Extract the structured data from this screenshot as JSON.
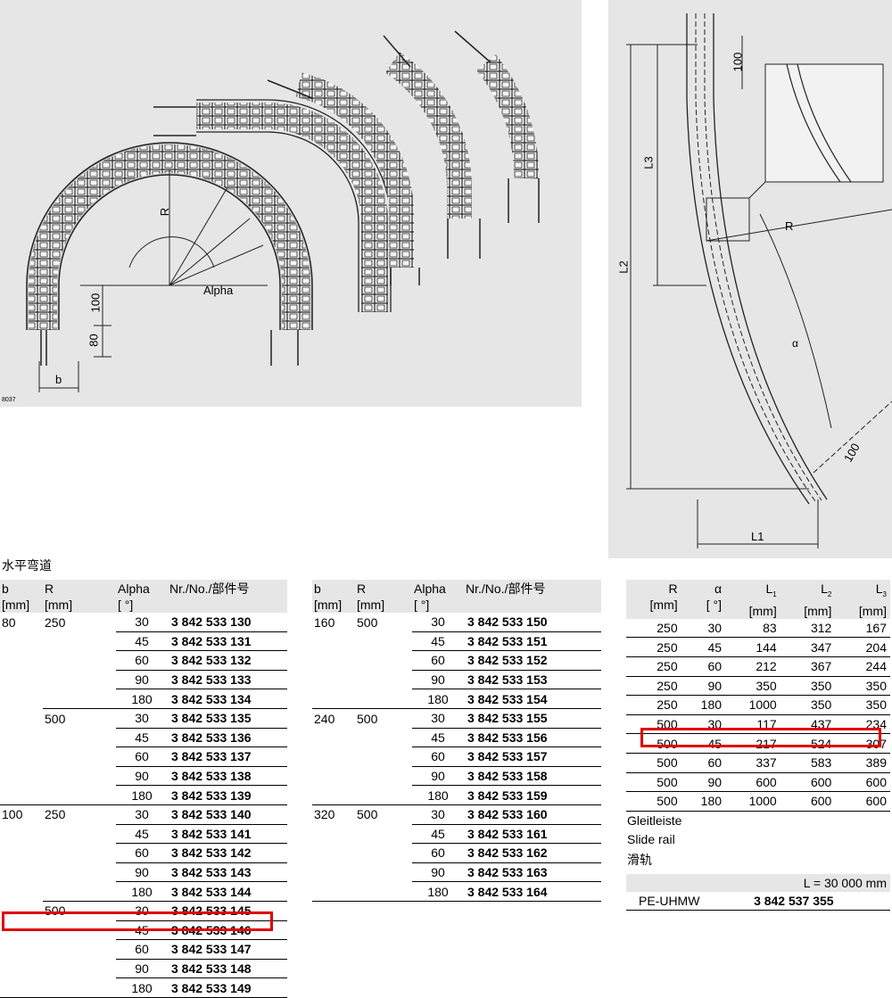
{
  "figure_left": {
    "labels": {
      "r": "R",
      "alpha": "Alpha",
      "dim_100": "100",
      "dim_80": "80",
      "b": "b",
      "fig_id": "8037"
    }
  },
  "figure_right": {
    "labels": {
      "dim_100_top": "100",
      "l3": "L3",
      "r": "R",
      "l2": "L2",
      "alpha": "α",
      "dim_100_bottom": "100",
      "l1": "L1"
    }
  },
  "section_title": "水平弯道",
  "table1": {
    "headers": {
      "b": "b",
      "b_unit": "[mm]",
      "r": "R",
      "r_unit": "[mm]",
      "alpha": "Alpha",
      "alpha_unit": "[ °]",
      "nr": "Nr./No./部件号"
    },
    "rows": [
      {
        "b": "80",
        "r": "250",
        "a": "30",
        "nr": "3 842 533 130"
      },
      {
        "b": "",
        "r": "",
        "a": "45",
        "nr": "3 842 533 131"
      },
      {
        "b": "",
        "r": "",
        "a": "60",
        "nr": "3 842 533 132"
      },
      {
        "b": "",
        "r": "",
        "a": "90",
        "nr": "3 842 533 133"
      },
      {
        "b": "",
        "r": "",
        "a": "180",
        "nr": "3 842 533 134"
      },
      {
        "b": "",
        "r": "500",
        "a": "30",
        "nr": "3 842 533 135"
      },
      {
        "b": "",
        "r": "",
        "a": "45",
        "nr": "3 842 533 136"
      },
      {
        "b": "",
        "r": "",
        "a": "60",
        "nr": "3 842 533 137"
      },
      {
        "b": "",
        "r": "",
        "a": "90",
        "nr": "3 842 533 138"
      },
      {
        "b": "",
        "r": "",
        "a": "180",
        "nr": "3 842 533 139"
      },
      {
        "b": "100",
        "r": "250",
        "a": "30",
        "nr": "3 842 533 140"
      },
      {
        "b": "",
        "r": "",
        "a": "45",
        "nr": "3 842 533 141"
      },
      {
        "b": "",
        "r": "",
        "a": "60",
        "nr": "3 842 533 142"
      },
      {
        "b": "",
        "r": "",
        "a": "90",
        "nr": "3 842 533 143"
      },
      {
        "b": "",
        "r": "",
        "a": "180",
        "nr": "3 842 533 144"
      },
      {
        "b": "",
        "r": "500",
        "a": "30",
        "nr": "3 842 533 145"
      },
      {
        "b": "",
        "r": "",
        "a": "45",
        "nr": "3 842 533 146"
      },
      {
        "b": "",
        "r": "",
        "a": "60",
        "nr": "3 842 533 147"
      },
      {
        "b": "",
        "r": "",
        "a": "90",
        "nr": "3 842 533 148"
      },
      {
        "b": "",
        "r": "",
        "a": "180",
        "nr": "3 842 533 149"
      }
    ]
  },
  "table2": {
    "headers": {
      "b": "b",
      "b_unit": "[mm]",
      "r": "R",
      "r_unit": "[mm]",
      "alpha": "Alpha",
      "alpha_unit": "[ °]",
      "nr": "Nr./No./部件号"
    },
    "rows": [
      {
        "b": "160",
        "r": "500",
        "a": "30",
        "nr": "3 842 533 150"
      },
      {
        "b": "",
        "r": "",
        "a": "45",
        "nr": "3 842 533 151"
      },
      {
        "b": "",
        "r": "",
        "a": "60",
        "nr": "3 842 533 152"
      },
      {
        "b": "",
        "r": "",
        "a": "90",
        "nr": "3 842 533 153"
      },
      {
        "b": "",
        "r": "",
        "a": "180",
        "nr": "3 842 533 154"
      },
      {
        "b": "240",
        "r": "500",
        "a": "30",
        "nr": "3 842 533 155"
      },
      {
        "b": "",
        "r": "",
        "a": "45",
        "nr": "3 842 533 156"
      },
      {
        "b": "",
        "r": "",
        "a": "60",
        "nr": "3 842 533 157"
      },
      {
        "b": "",
        "r": "",
        "a": "90",
        "nr": "3 842 533 158"
      },
      {
        "b": "",
        "r": "",
        "a": "180",
        "nr": "3 842 533 159"
      },
      {
        "b": "320",
        "r": "500",
        "a": "30",
        "nr": "3 842 533 160"
      },
      {
        "b": "",
        "r": "",
        "a": "45",
        "nr": "3 842 533 161"
      },
      {
        "b": "",
        "r": "",
        "a": "60",
        "nr": "3 842 533 162"
      },
      {
        "b": "",
        "r": "",
        "a": "90",
        "nr": "3 842 533 163"
      },
      {
        "b": "",
        "r": "",
        "a": "180",
        "nr": "3 842 533 164"
      }
    ]
  },
  "table3": {
    "headers": {
      "r": "R",
      "r_unit": "[mm]",
      "a": "α",
      "a_unit": "[ °]",
      "l1": "L",
      "l1_sub": "1",
      "l1_unit": "[mm]",
      "l2": "L",
      "l2_sub": "2",
      "l2_unit": "[mm]",
      "l3": "L",
      "l3_sub": "3",
      "l3_unit": "[mm]"
    },
    "rows": [
      {
        "r": "250",
        "a": "30",
        "l1": "83",
        "l2": "312",
        "l3": "167"
      },
      {
        "r": "250",
        "a": "45",
        "l1": "144",
        "l2": "347",
        "l3": "204"
      },
      {
        "r": "250",
        "a": "60",
        "l1": "212",
        "l2": "367",
        "l3": "244"
      },
      {
        "r": "250",
        "a": "90",
        "l1": "350",
        "l2": "350",
        "l3": "350"
      },
      {
        "r": "250",
        "a": "180",
        "l1": "1000",
        "l2": "350",
        "l3": "350"
      },
      {
        "r": "500",
        "a": "30",
        "l1": "117",
        "l2": "437",
        "l3": "234"
      },
      {
        "r": "500",
        "a": "45",
        "l1": "217",
        "l2": "524",
        "l3": "307"
      },
      {
        "r": "500",
        "a": "60",
        "l1": "337",
        "l2": "583",
        "l3": "389"
      },
      {
        "r": "500",
        "a": "90",
        "l1": "600",
        "l2": "600",
        "l3": "600"
      },
      {
        "r": "500",
        "a": "180",
        "l1": "1000",
        "l2": "600",
        "l3": "600"
      }
    ]
  },
  "slide_rail": {
    "title_de": "Gleitleiste",
    "title_en": "Slide rail",
    "title_cn": "滑轨",
    "length": "L = 30 000 mm",
    "material": "PE-UHMW",
    "part_no": "3 842 537 355"
  },
  "highlight_color": "#e00000"
}
